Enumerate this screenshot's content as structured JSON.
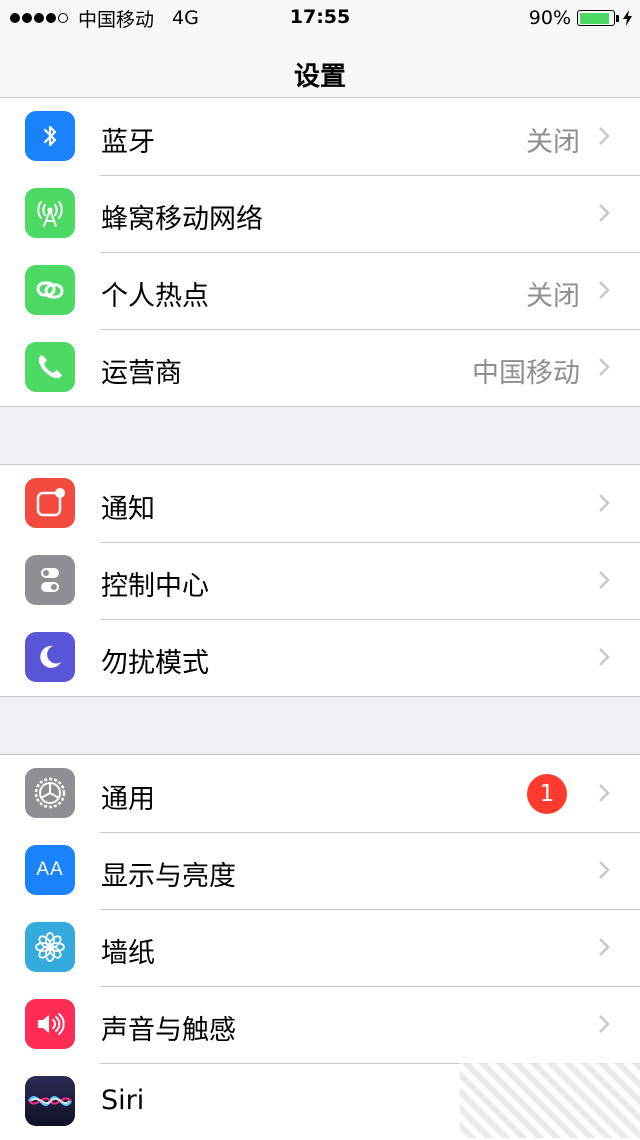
{
  "status_bar": {
    "carrier": "中国移动",
    "network": "4G",
    "time": "17:55",
    "battery_text": "90%",
    "battery_level": 0.9,
    "signal_bars_filled": 4,
    "signal_bars_total": 5
  },
  "nav": {
    "title": "设置"
  },
  "groups": [
    {
      "rows": [
        {
          "label": "蓝牙",
          "value": "关闭",
          "icon": "bluetooth-icon",
          "color": "#1a82fb"
        },
        {
          "label": "蜂窝移动网络",
          "value": "",
          "icon": "cellular-antenna-icon",
          "color": "#4cd964"
        },
        {
          "label": "个人热点",
          "value": "关闭",
          "icon": "personal-hotspot-icon",
          "color": "#4cd964"
        },
        {
          "label": "运营商",
          "value": "中国移动",
          "icon": "phone-icon",
          "color": "#4cd964"
        }
      ]
    },
    {
      "rows": [
        {
          "label": "通知",
          "value": "",
          "icon": "notifications-icon",
          "color": "#f24a3e"
        },
        {
          "label": "控制中心",
          "value": "",
          "icon": "control-center-icon",
          "color": "#8e8e93"
        },
        {
          "label": "勿扰模式",
          "value": "",
          "icon": "moon-icon",
          "color": "#5856d6"
        }
      ]
    },
    {
      "rows": [
        {
          "label": "通用",
          "value": "",
          "badge": "1",
          "icon": "gear-icon",
          "color": "#8e8e93"
        },
        {
          "label": "显示与亮度",
          "value": "",
          "icon": "display-brightness-icon",
          "color": "#1a82fb"
        },
        {
          "label": "墙纸",
          "value": "",
          "icon": "wallpaper-flower-icon",
          "color": "#35aadc"
        },
        {
          "label": "声音与触感",
          "value": "",
          "icon": "speaker-icon",
          "color": "#ff2d55"
        },
        {
          "label": "Siri",
          "value": "",
          "icon": "siri-icon",
          "color": "#1c1c3a"
        }
      ]
    }
  ],
  "icons_text": {
    "display": "AA"
  }
}
